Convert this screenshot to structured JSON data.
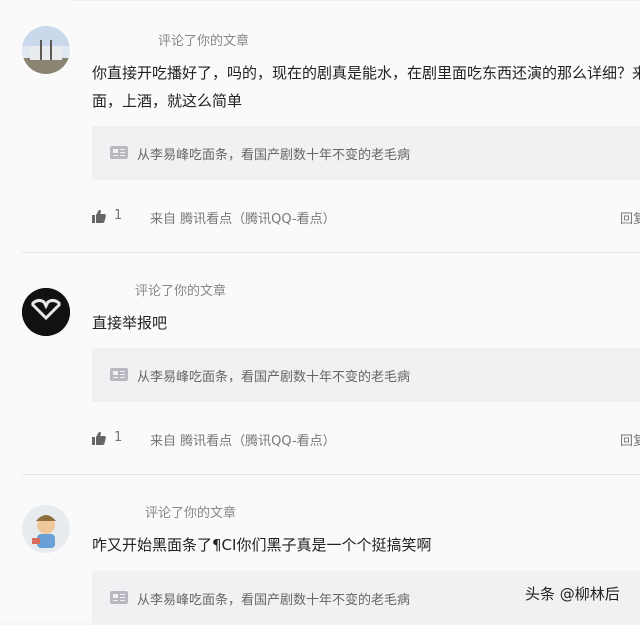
{
  "comments": [
    {
      "action": "评论了你的文章",
      "text_line1": "你直接开吃播好了，吗的，现在的剧真是能水，在剧里面吃东西还演的那么详细？来",
      "text_line2": "面，上酒，就这么简单",
      "quote": "从李易峰吃面条，看国产剧数十年不变的老毛病",
      "likes": "1",
      "source": "来自 腾讯看点（腾讯QQ-看点）",
      "reply": "回复"
    },
    {
      "action": "评论了你的文章",
      "text_line1": "直接举报吧",
      "quote": "从李易峰吃面条，看国产剧数十年不变的老毛病",
      "likes": "1",
      "source": "来自 腾讯看点（腾讯QQ-看点）",
      "reply": "回复"
    },
    {
      "action": "评论了你的文章",
      "text_line1": "咋又开始黑面条了¶CI你们黑子真是一个个挺搞笑啊",
      "quote": "从李易峰吃面条，看国产剧数十年不变的老毛病"
    }
  ],
  "watermark": "头条 @柳林后",
  "icons": {
    "thumb": "thumbs-up-icon",
    "article": "article-icon"
  },
  "colors": {
    "background": "#fafafb",
    "quote_bg": "#f1f1f4",
    "text": "#222222",
    "muted": "#888888"
  }
}
